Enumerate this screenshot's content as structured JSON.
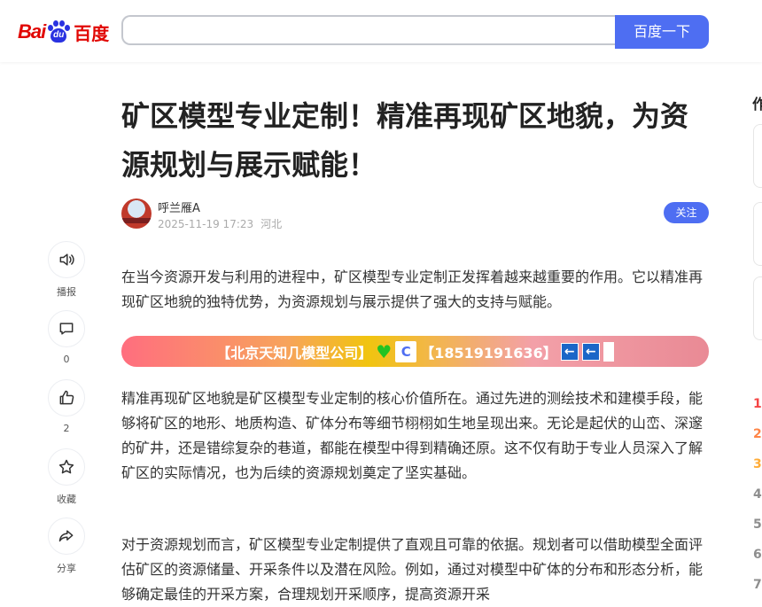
{
  "header": {
    "logo": {
      "bai": "Bai",
      "du": "du",
      "baidu": "百度"
    },
    "search_placeholder": "",
    "search_button": "百度一下"
  },
  "article": {
    "title": "矿区模型专业定制！精准再现矿区地貌，为资源规划与展示赋能！",
    "author": "呼兰雁A",
    "datetime": "2025-11-19 17:23",
    "location": "河北",
    "follow_label": "关注",
    "intro": "在当今资源开发与利用的进程中，矿区模型专业定制正发挥着越来越重要的作用。它以精准再现矿区地貌的独特优势，为资源规划与展示提供了强大的支持与赋能。",
    "banner": {
      "company": "【北京天知几模型公司】",
      "phone": "【18519191636】",
      "heart": "♥",
      "c_icon": "C",
      "arrow": "←"
    },
    "para2": "精准再现矿区地貌是矿区模型专业定制的核心价值所在。通过先进的测绘技术和建模手段，能够将矿区的地形、地质构造、矿体分布等细节栩栩如生地呈现出来。无论是起伏的山峦、深邃的矿井，还是错综复杂的巷道，都能在模型中得到精确还原。这不仅有助于专业人员深入了解矿区的实际情况，也为后续的资源规划奠定了坚实基础。",
    "para3": "对于资源规划而言，矿区模型专业定制提供了直观且可靠的依据。规划者可以借助模型全面评估矿区的资源储量、开采条件以及潜在风险。例如，通过对模型中矿体的分布和形态分析，能够确定最佳的开采方案，合理规划开采顺序，提高资源开采"
  },
  "sidebar_actions": [
    {
      "icon": "speaker-icon",
      "label": "播报"
    },
    {
      "icon": "comment-icon",
      "label": "0"
    },
    {
      "icon": "thumbs-up-icon",
      "label": "2"
    },
    {
      "icon": "star-icon",
      "label": "收藏"
    },
    {
      "icon": "share-icon",
      "label": "分享"
    }
  ],
  "right_rail": {
    "peek_text": "作",
    "ranks": [
      {
        "n": "1",
        "color": "#f54545"
      },
      {
        "n": "2",
        "color": "#ff8547"
      },
      {
        "n": "3",
        "color": "#ffac38"
      },
      {
        "n": "4",
        "color": "#8e8e8e"
      },
      {
        "n": "5",
        "color": "#8e8e8e"
      },
      {
        "n": "6",
        "color": "#8e8e8e"
      },
      {
        "n": "7",
        "color": "#8e8e8e"
      }
    ]
  },
  "colors": {
    "brand_blue": "#4e6ef2",
    "brand_red": "#e10602",
    "paw_blue": "#2932e1"
  }
}
